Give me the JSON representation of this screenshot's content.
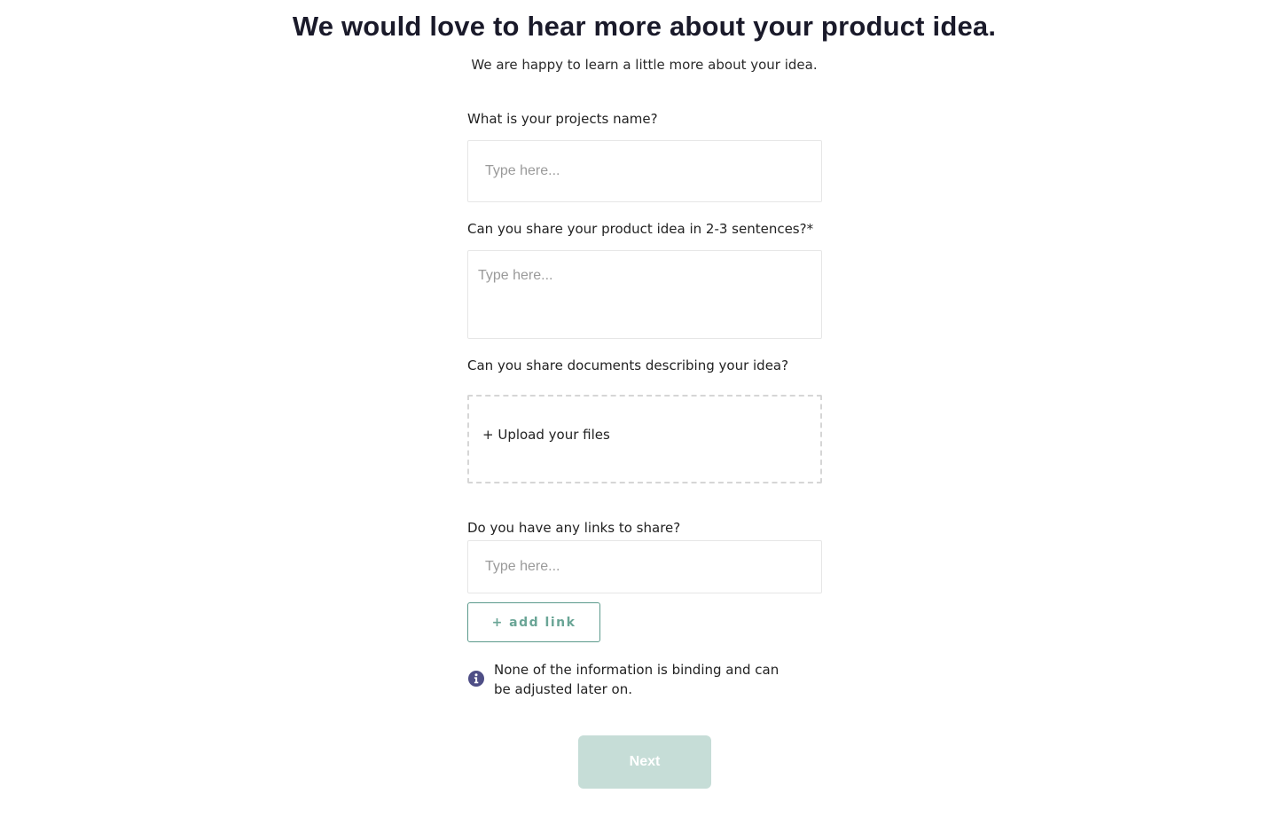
{
  "header": {
    "title": "We would love to hear more about your product idea.",
    "subtitle": "We are happy to learn a little more about your idea."
  },
  "form": {
    "project_name": {
      "label": "What is your projects name?",
      "placeholder": "Type here...",
      "value": ""
    },
    "product_idea": {
      "label": "Can you share your product idea in 2-3 sentences?*",
      "placeholder": "Type here...",
      "value": ""
    },
    "documents": {
      "label": "Can you share documents describing your idea?",
      "upload_label": "+ Upload your files"
    },
    "links": {
      "label": "Do you have any links to share?",
      "placeholder": "Type here...",
      "value": "",
      "add_link_label": "+ add link"
    },
    "info": {
      "icon": "info-icon",
      "text": "None of the information is binding and can be adjusted later on."
    },
    "next_label": "Next"
  },
  "colors": {
    "accent": "#5c9a8c",
    "next_button_bg": "#c6ddd7",
    "info_icon": "#4e4e86"
  }
}
